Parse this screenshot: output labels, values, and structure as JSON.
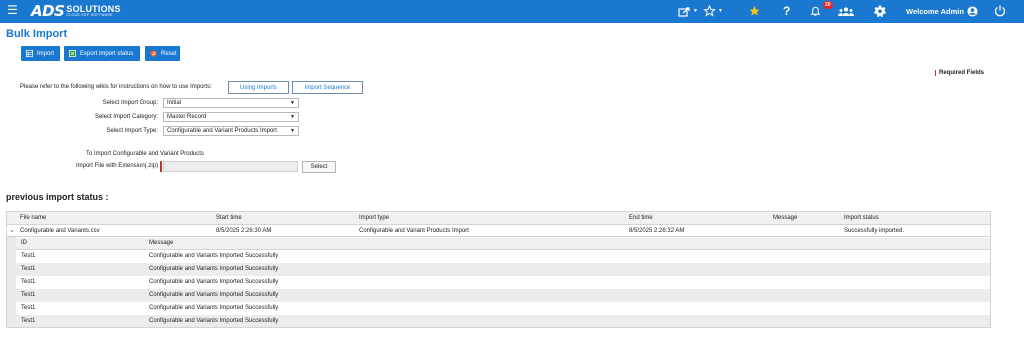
{
  "topbar": {
    "logo_mark": "ADS",
    "logo_name": "SOLUTIONS",
    "logo_tagline": "CLOUD ERP SOFTWARE",
    "notification_count": "20",
    "welcome_text": "Welcome Admin",
    "icons": [
      "menu-icon",
      "share-icon",
      "star-outline-icon",
      "favorites-star-icon",
      "help-icon",
      "bell-icon",
      "users-icon",
      "gear-icon",
      "user-circle-icon",
      "power-icon"
    ]
  },
  "page": {
    "title": "Bulk Import",
    "required_fields": "Required Fields"
  },
  "toolbar": {
    "import_label": "Import",
    "export_label": "Export import status",
    "reset_label": "Reset"
  },
  "wiki": {
    "label": "Please refer to the following wikis for instructions on how to use Imports:",
    "using_imports": "Using Imports",
    "import_sequence": "Import Sequence"
  },
  "form": {
    "group_label": "Select Import Group:",
    "group_value": "Initial",
    "category_label": "Select Import Category:",
    "category_value": "Master Record",
    "type_label": "Select Import Type:",
    "type_value": "Configurable and Variant Products Import",
    "caption": "To Import Configurable and Variant Products",
    "file_label": "Import File with Extension(.zip)",
    "select_button": "Select"
  },
  "status": {
    "title": "previous import status :",
    "columns": [
      "File name",
      "Start time",
      "Import type",
      "End time",
      "Message",
      "Import status"
    ],
    "row": {
      "file_name": "Configurable and Variants.csv",
      "start_time": "8/5/2025 2:26:30 AM",
      "import_type": "Configurable and Variant Products Import",
      "end_time": "8/5/2025 2:26:32 AM",
      "message": "",
      "status": "Successfully imported."
    },
    "detail_columns": [
      "ID",
      "Message"
    ],
    "detail_rows": [
      {
        "id": "Test1",
        "message": "Configurable and Variants Imported Successfully"
      },
      {
        "id": "Test1",
        "message": "Configurable and Variants Imported Successfully"
      },
      {
        "id": "Test1",
        "message": "Configurable and Variants Imported Successfully"
      },
      {
        "id": "Test1",
        "message": "Configurable and Variants Imported Successfully"
      },
      {
        "id": "Test1",
        "message": "Configurable and Variants Imported Successfully"
      },
      {
        "id": "Test1",
        "message": "Configurable and Variants Imported Successfully"
      }
    ]
  },
  "colors": {
    "brand_blue": "#1b78d0",
    "favorite_yellow": "#f6c90e",
    "badge_red": "#e4242a",
    "required_red": "#c0392b",
    "reset_icon_orange": "#e8622a"
  }
}
